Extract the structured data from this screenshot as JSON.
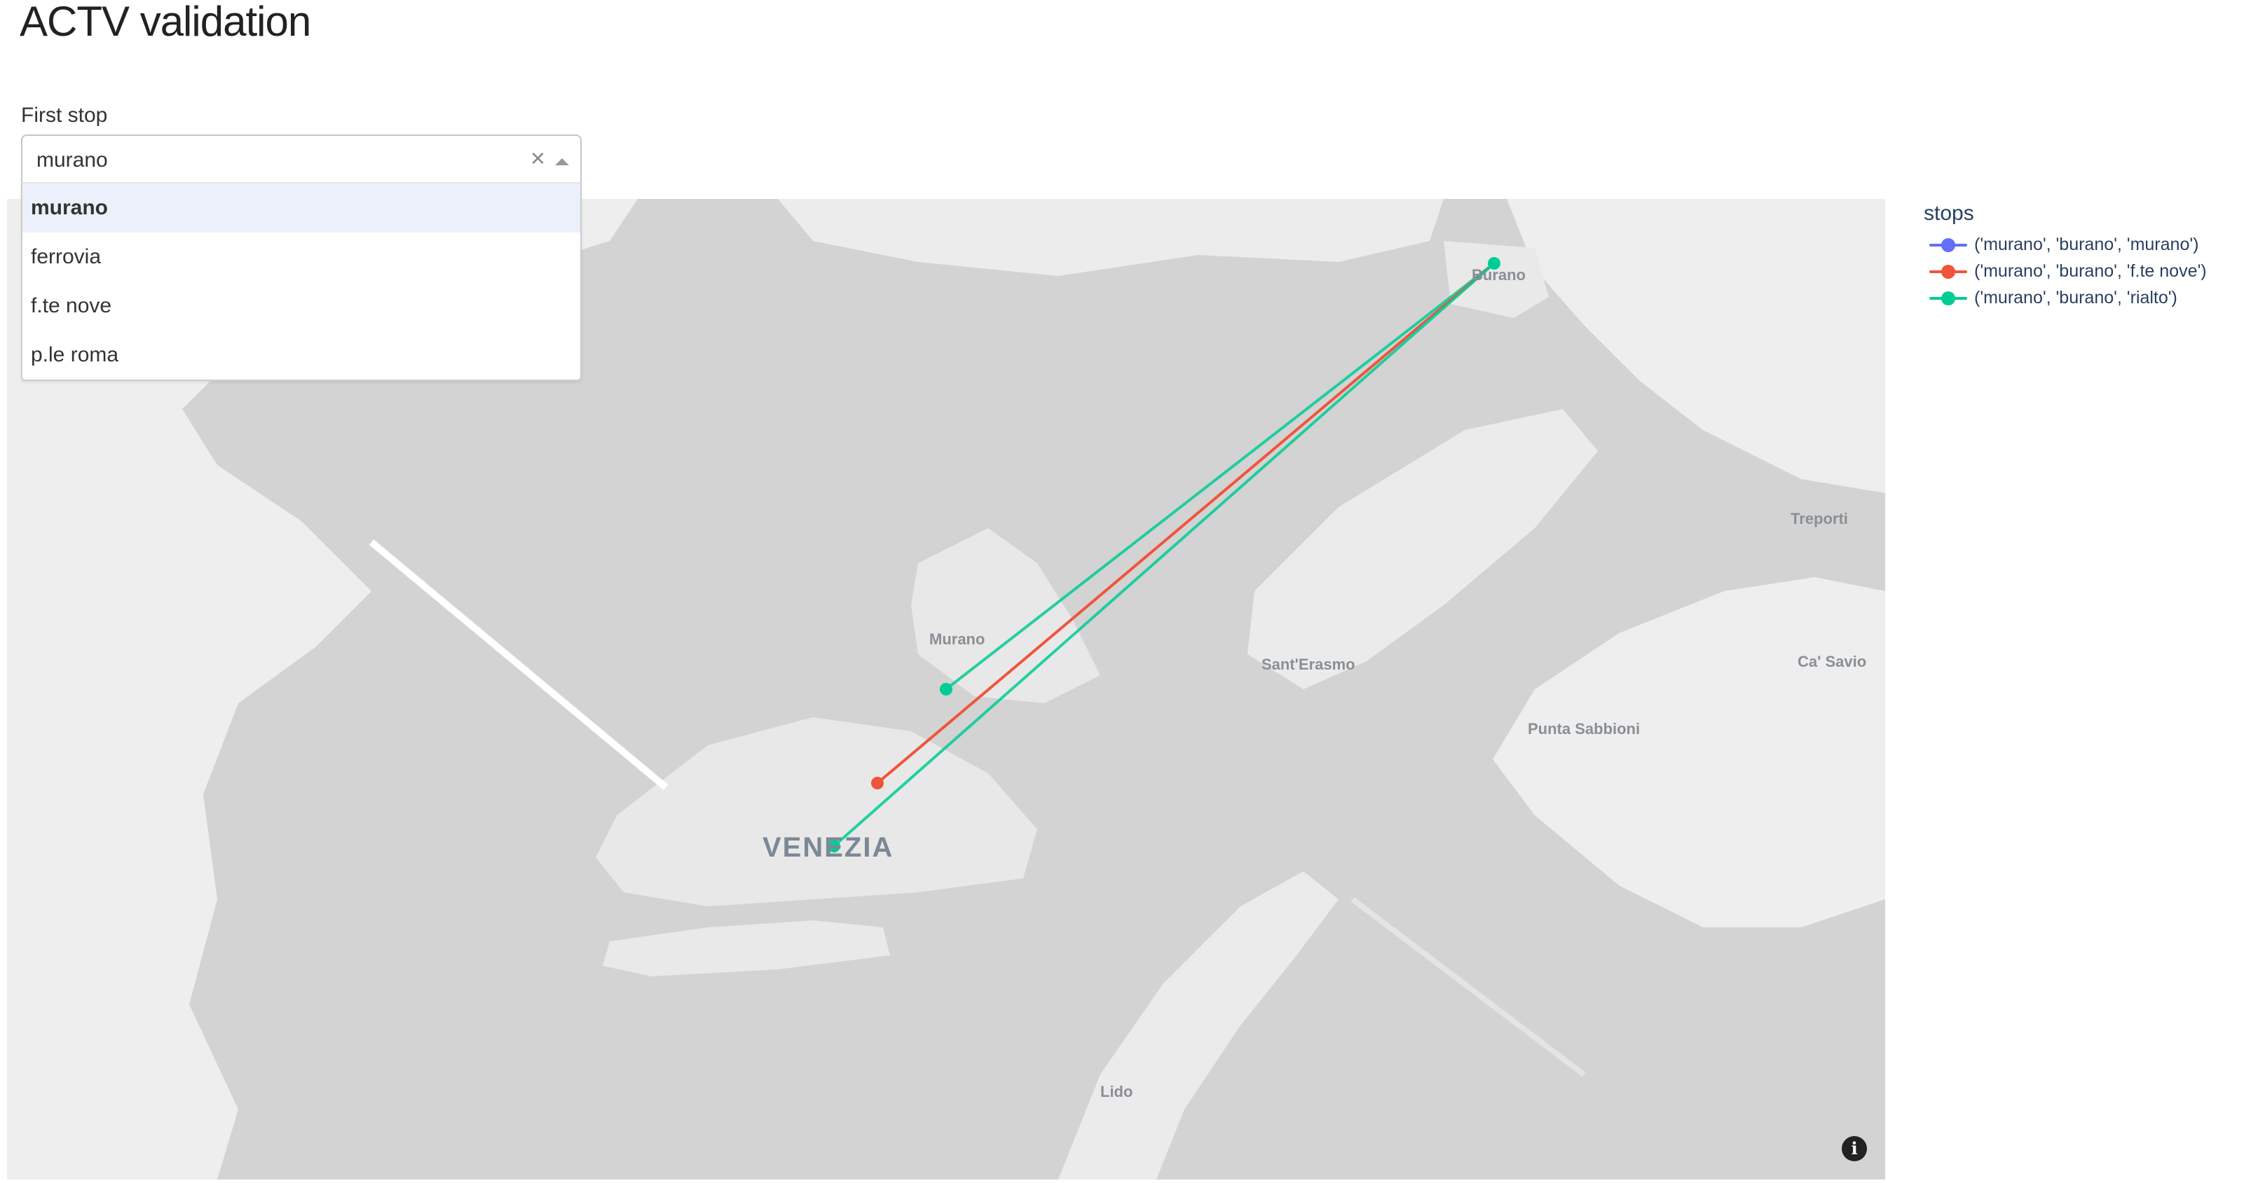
{
  "page": {
    "title": "ACTV validation"
  },
  "dropdown": {
    "label": "First stop",
    "value": "murano",
    "clear_glyph": "×",
    "options": [
      "murano",
      "ferrovia",
      "f.te nove",
      "p.le roma"
    ]
  },
  "map": {
    "place_labels": [
      "Burano",
      "Treporti",
      "Murano",
      "Sant'Erasmo",
      "Ca' Savio",
      "Punta Sabbioni",
      "VENEZIA",
      "Lido"
    ],
    "info_glyph": "i",
    "colors": {
      "water": "#d3d3d3",
      "land": "#f2f2f2"
    }
  },
  "legend": {
    "title": "stops",
    "items": [
      {
        "label": "('murano', 'burano', 'murano')",
        "color": "#636efa"
      },
      {
        "label": "('murano', 'burano', 'f.te nove')",
        "color": "#ef553b"
      },
      {
        "label": "('murano', 'burano', 'rialto')",
        "color": "#00cc96"
      }
    ]
  }
}
